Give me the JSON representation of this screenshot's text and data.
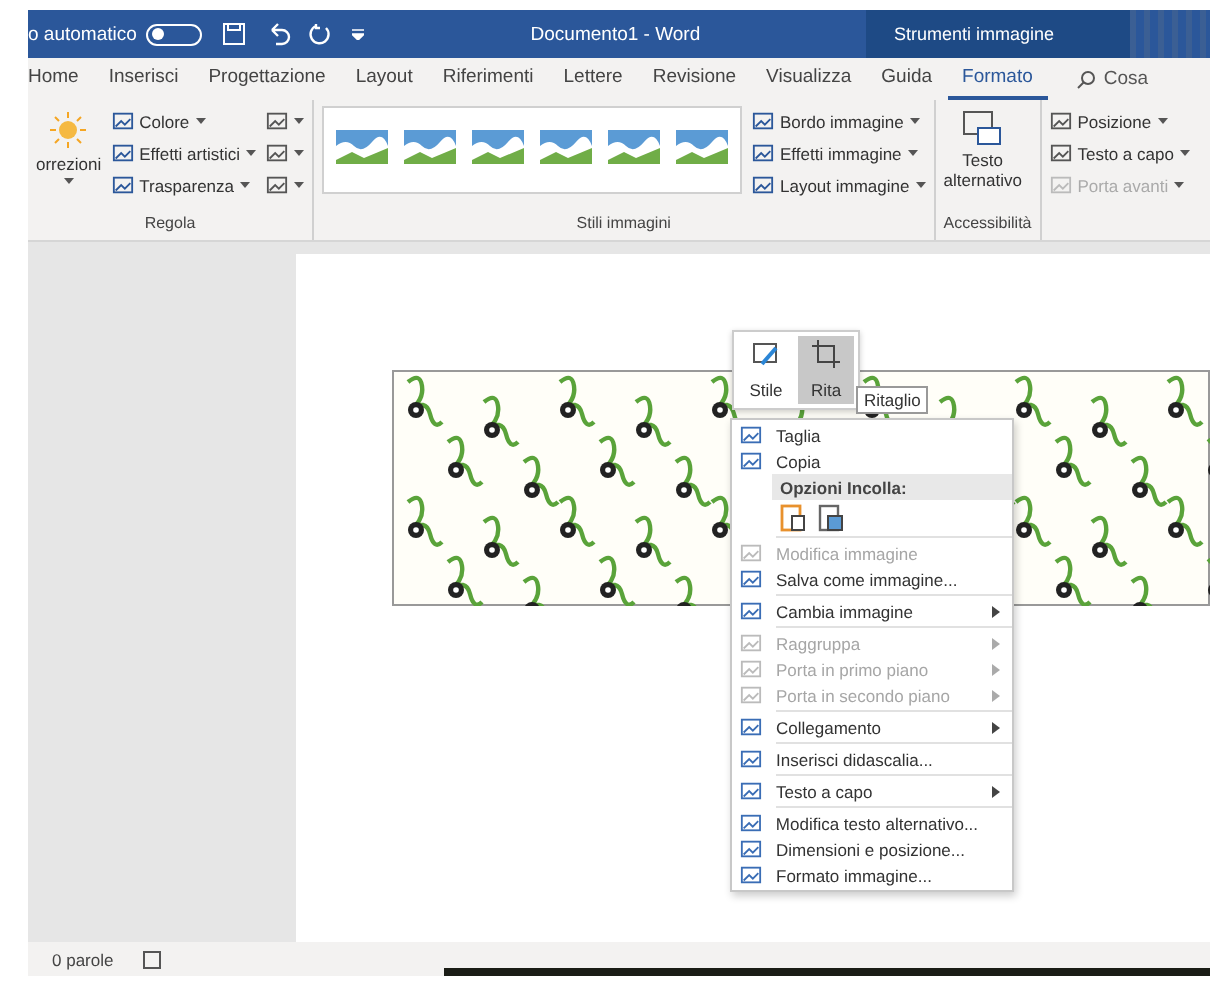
{
  "title_bar": {
    "autosave_label": "o automatico",
    "autosave_on": false,
    "title": "Documento1  -  Word",
    "context_tab": "Strumenti immagine"
  },
  "tabs": [
    {
      "label": "Home",
      "selected": false
    },
    {
      "label": "Inserisci",
      "selected": false
    },
    {
      "label": "Progettazione",
      "selected": false
    },
    {
      "label": "Layout",
      "selected": false
    },
    {
      "label": "Riferimenti",
      "selected": false
    },
    {
      "label": "Lettere",
      "selected": false
    },
    {
      "label": "Revisione",
      "selected": false
    },
    {
      "label": "Visualizza",
      "selected": false
    },
    {
      "label": "Guida",
      "selected": false
    },
    {
      "label": "Formato",
      "selected": true
    }
  ],
  "search": {
    "placeholder": "Cosa"
  },
  "ribbon": {
    "regola": {
      "big_label": "orrezioni",
      "items": [
        "Colore",
        "Effetti artistici",
        "Trasparenza"
      ],
      "group_label": "Regola"
    },
    "stili": {
      "group_label": "Stili immagini",
      "items": [
        "Bordo immagine",
        "Effetti immagine",
        "Layout immagine"
      ]
    },
    "accessibilita": {
      "button_lines": [
        "Testo",
        "alternativo"
      ],
      "group_label": "Accessibilità"
    },
    "disponi": [
      {
        "label": "Posizione",
        "disabled": false
      },
      {
        "label": "Testo a capo",
        "disabled": false
      },
      {
        "label": "Porta avanti",
        "disabled": true
      }
    ]
  },
  "mini_toolbar": [
    {
      "label": "Stile",
      "selected": false
    },
    {
      "label": "Rita",
      "selected": true
    }
  ],
  "tooltip": "Ritaglio",
  "context_menu": [
    {
      "kind": "item",
      "label": "Taglia",
      "disabled": false,
      "submenu": false
    },
    {
      "kind": "item",
      "label": "Copia",
      "disabled": false,
      "submenu": false
    },
    {
      "kind": "header",
      "label": "Opzioni Incolla:"
    },
    {
      "kind": "paste"
    },
    {
      "kind": "separator"
    },
    {
      "kind": "item",
      "label": "Modifica immagine",
      "disabled": true,
      "submenu": false
    },
    {
      "kind": "item",
      "label": "Salva come immagine...",
      "disabled": false,
      "submenu": false
    },
    {
      "kind": "separator"
    },
    {
      "kind": "item",
      "label": "Cambia immagine",
      "disabled": false,
      "submenu": true
    },
    {
      "kind": "separator"
    },
    {
      "kind": "item",
      "label": "Raggruppa",
      "disabled": true,
      "submenu": true
    },
    {
      "kind": "item",
      "label": "Porta in primo piano",
      "disabled": true,
      "submenu": true
    },
    {
      "kind": "item",
      "label": "Porta in secondo piano",
      "disabled": true,
      "submenu": true
    },
    {
      "kind": "separator"
    },
    {
      "kind": "item",
      "label": "Collegamento",
      "disabled": false,
      "submenu": true
    },
    {
      "kind": "separator"
    },
    {
      "kind": "item",
      "label": "Inserisci didascalia...",
      "disabled": false,
      "submenu": false
    },
    {
      "kind": "separator"
    },
    {
      "kind": "item",
      "label": "Testo a capo",
      "disabled": false,
      "submenu": true
    },
    {
      "kind": "separator"
    },
    {
      "kind": "item",
      "label": "Modifica testo alternativo...",
      "disabled": false,
      "submenu": false
    },
    {
      "kind": "item",
      "label": "Dimensioni e posizione...",
      "disabled": false,
      "submenu": false
    },
    {
      "kind": "item",
      "label": "Formato immagine...",
      "disabled": false,
      "submenu": false
    }
  ],
  "status_bar": {
    "words": "0 parole"
  }
}
